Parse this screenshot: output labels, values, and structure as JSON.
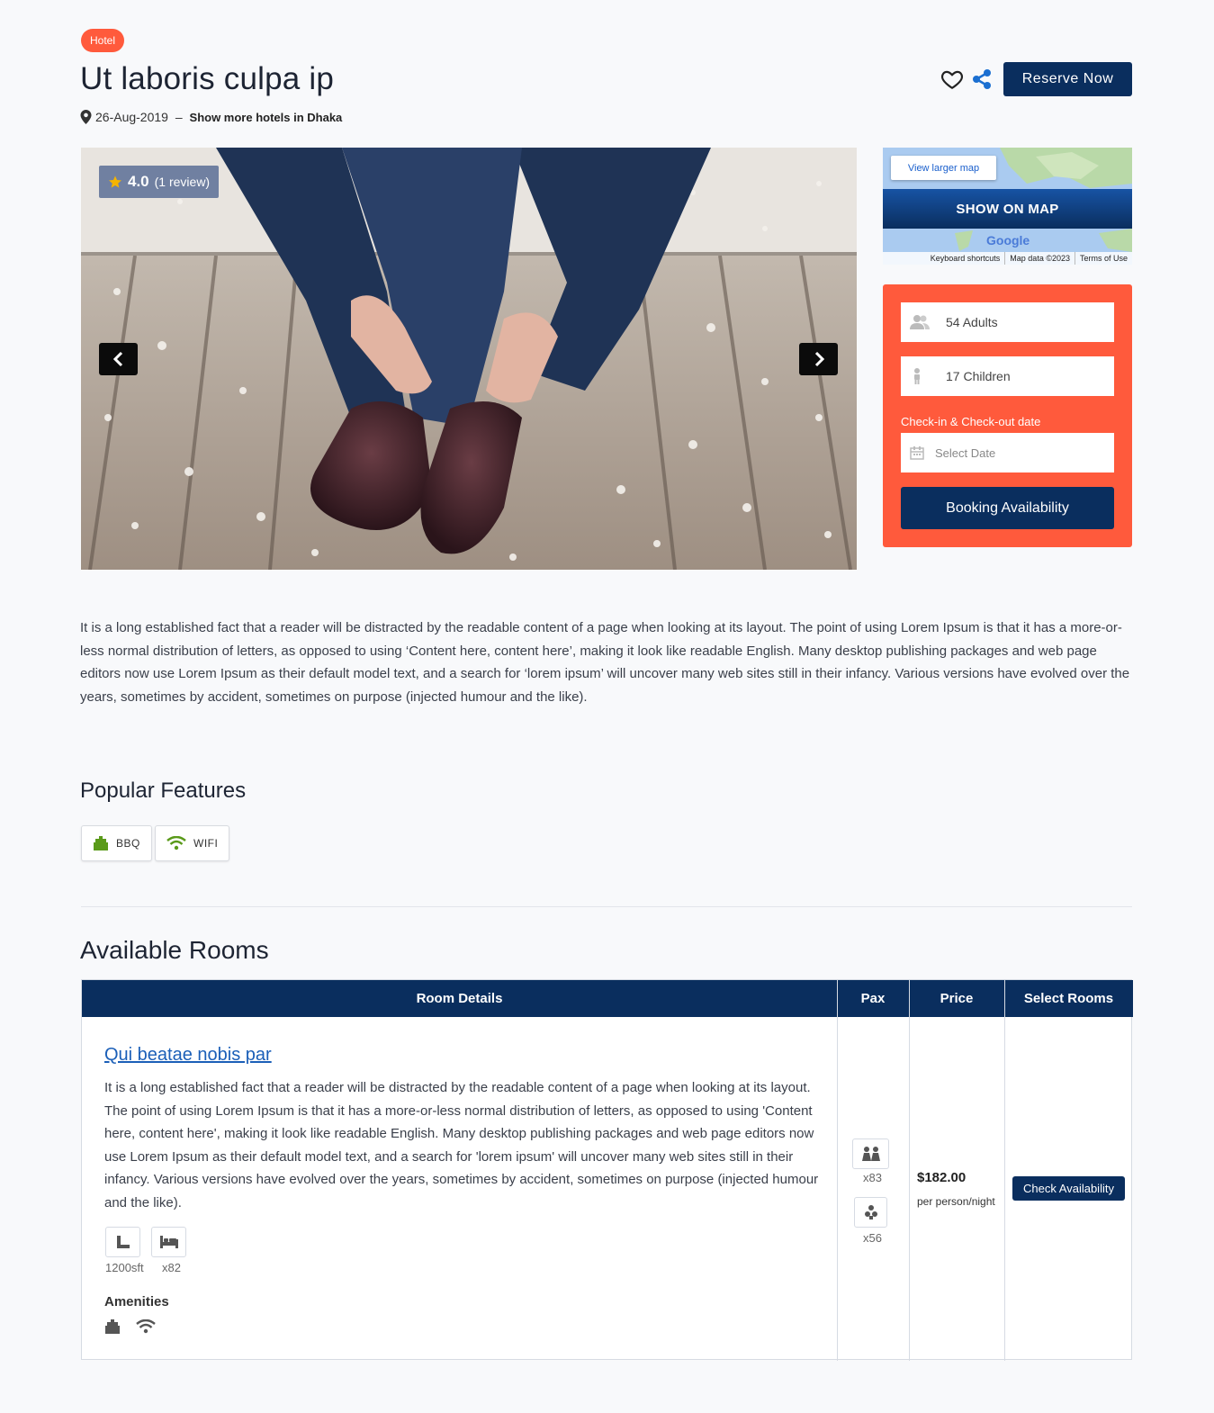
{
  "header": {
    "category_badge": "Hotel",
    "title": "Ut laboris culpa ip",
    "date": "26-Aug-2019",
    "separator": " – ",
    "location_link": "Show more hotels in Dhaka",
    "reserve_label": "Reserve Now"
  },
  "gallery": {
    "rating_score": "4.0",
    "rating_reviews": "(1 review)"
  },
  "map": {
    "view_larger": "View larger map",
    "show_on_map": "SHOW ON MAP",
    "google": "Google",
    "footer": [
      "Keyboard shortcuts",
      "Map data ©2023",
      "Terms of Use"
    ]
  },
  "booking": {
    "adults": "54 Adults",
    "children": "17 Children",
    "date_label": "Check-in & Check-out date",
    "date_placeholder": "Select Date",
    "submit": "Booking Availability"
  },
  "description": "It is a long established fact that a reader will be distracted by the readable content of a page when looking at its layout. The point of using Lorem Ipsum is that it has a more-or-less normal distribution of letters, as opposed to using ‘Content here, content here’, making it look like readable English. Many desktop publishing packages and web page editors now use Lorem Ipsum as their default model text, and a search for ‘lorem ipsum’ will uncover many web sites still in their infancy. Various versions have evolved over the years, sometimes by accident, sometimes on purpose (injected humour and the like).",
  "features": {
    "heading": "Popular Features",
    "items": [
      {
        "label": "BBQ",
        "icon": "bbq-icon"
      },
      {
        "label": "WIFI",
        "icon": "wifi-icon"
      }
    ]
  },
  "rooms": {
    "heading": "Available Rooms",
    "columns": [
      "Room Details",
      "Pax",
      "Price",
      "Select Rooms"
    ],
    "items": [
      {
        "name": "Qui beatae nobis par",
        "description": "It is a long established fact that a reader will be distracted by the readable content of a page when looking at its layout. The point of using Lorem Ipsum is that it has a more-or-less normal distribution of letters, as opposed to using 'Content here, content here', making it look like readable English. Many desktop publishing packages and web page editors now use Lorem Ipsum as their default model text, and a search for 'lorem ipsum' will uncover many web sites still in their infancy. Various versions have evolved over the years, sometimes by accident, sometimes on purpose (injected humour and the like).",
        "size": "1200sft",
        "beds": "x82",
        "amenities_label": "Amenities",
        "adults": "x83",
        "children": "x56",
        "price": "$182.00",
        "price_unit": "per person/night",
        "action": "Check Availability"
      }
    ]
  },
  "colors": {
    "accent": "#ff5a3c",
    "navy": "#0a2e5e",
    "link": "#1b5fb8",
    "feature_icon": "#5a9a1a"
  }
}
